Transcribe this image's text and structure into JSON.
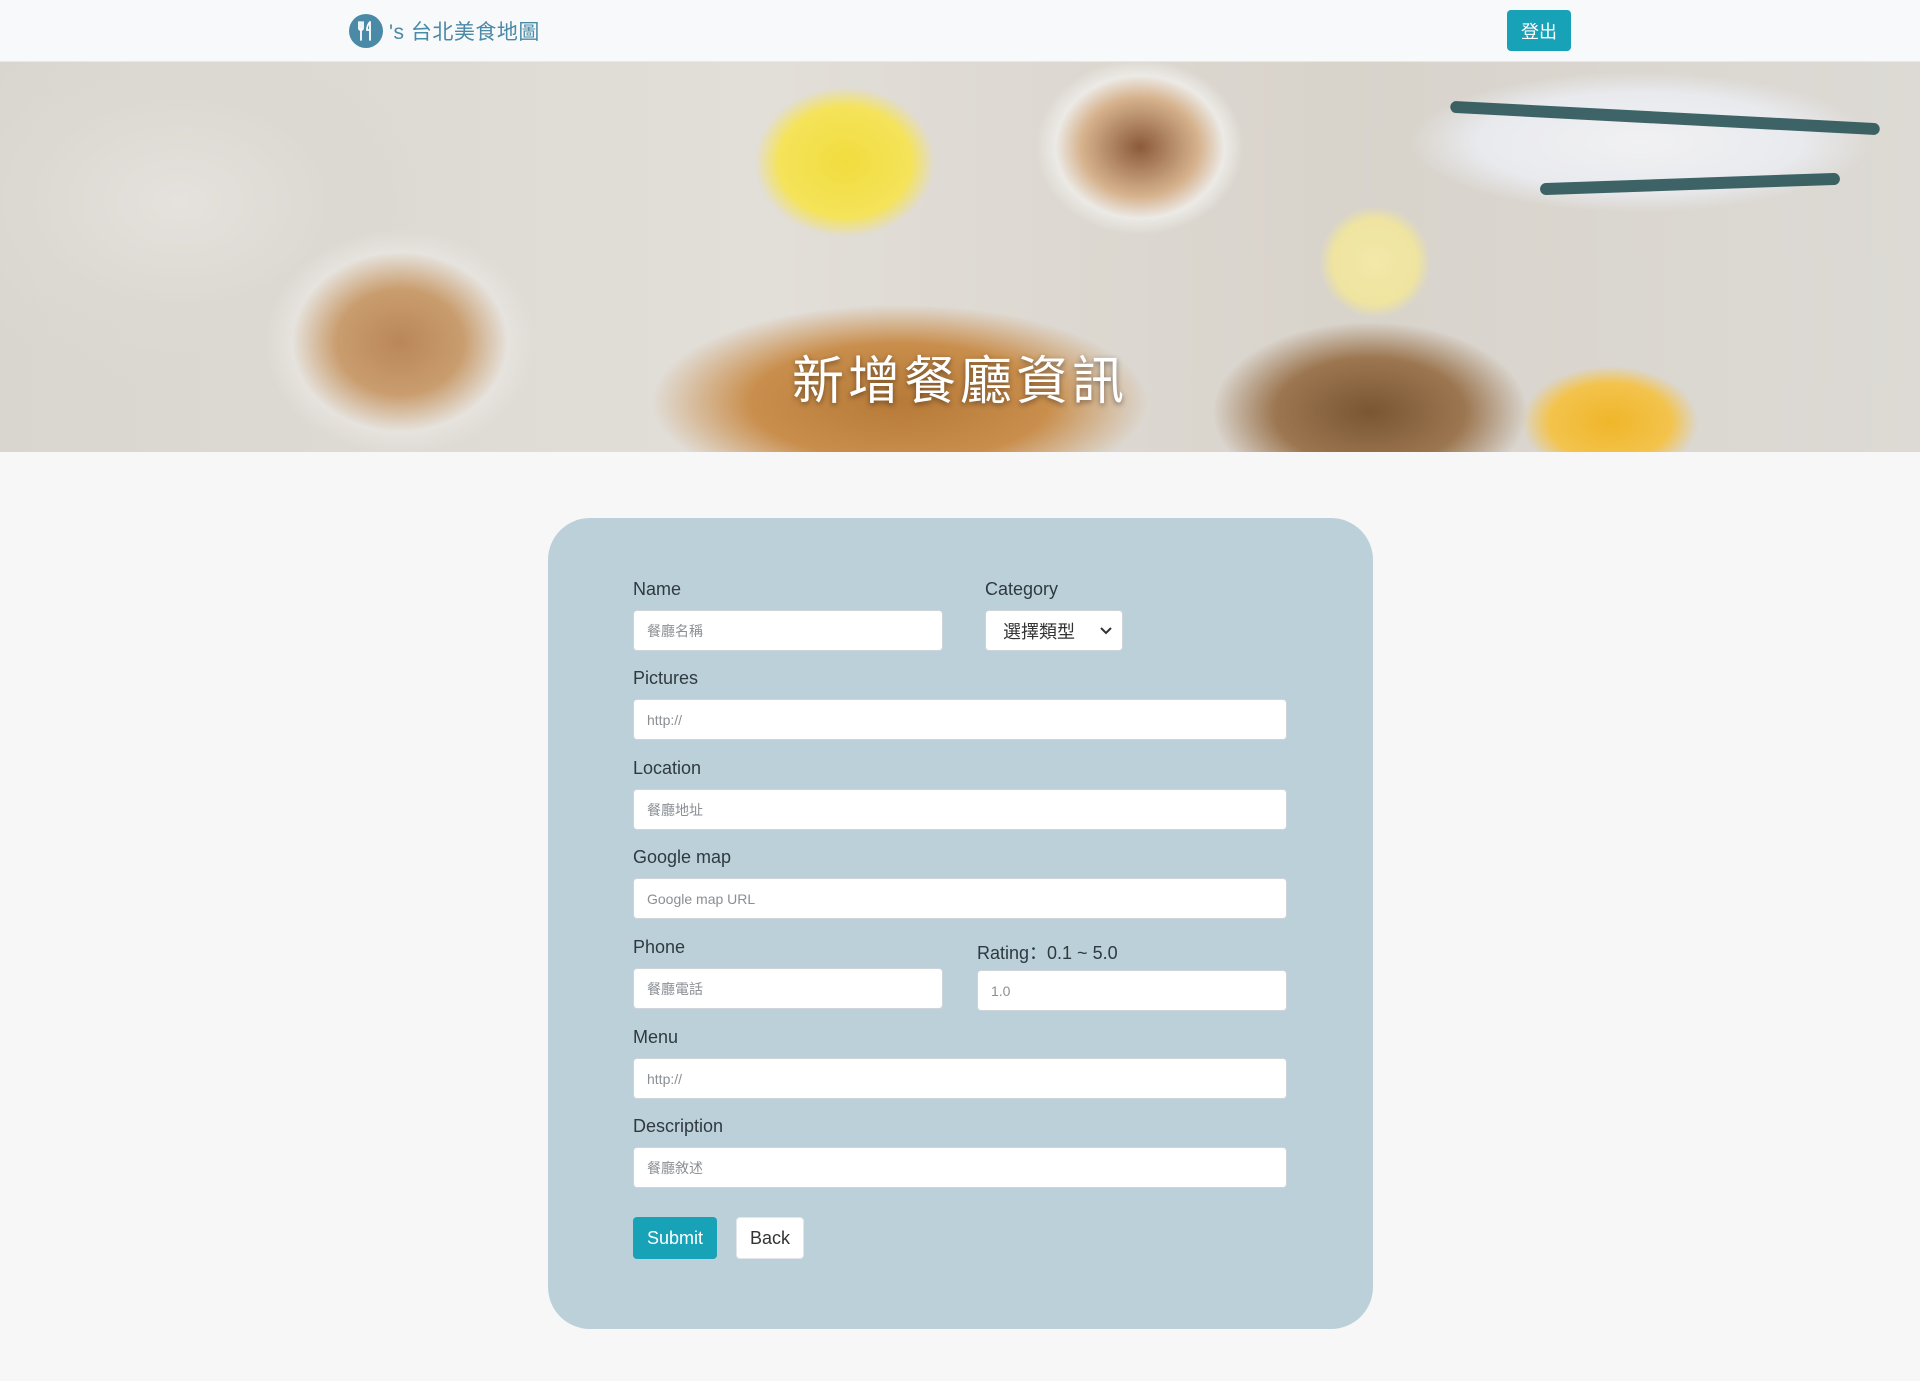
{
  "navbar": {
    "brand_text": "'s 台北美食地圖",
    "brand_icon": "utensils-icon",
    "logout_label": "登出",
    "accent_color": "#17a2b8",
    "brand_color": "#4a8aa6"
  },
  "banner": {
    "title": "新增餐廳資訊"
  },
  "form": {
    "background_color": "#bcd0d9",
    "name": {
      "label": "Name",
      "placeholder": "餐廳名稱",
      "value": ""
    },
    "category": {
      "label": "Category",
      "selected": "選擇類型"
    },
    "pictures": {
      "label": "Pictures",
      "placeholder": "http://",
      "value": ""
    },
    "location": {
      "label": "Location",
      "placeholder": "餐廳地址",
      "value": ""
    },
    "google_map": {
      "label": "Google map",
      "placeholder": "Google map URL",
      "value": ""
    },
    "phone": {
      "label": "Phone",
      "placeholder": "餐廳電話",
      "value": ""
    },
    "rating": {
      "label": "Rating：0.1 ~ 5.0",
      "placeholder": "1.0",
      "value": ""
    },
    "menu": {
      "label": "Menu",
      "placeholder": "http://",
      "value": ""
    },
    "description": {
      "label": "Description",
      "placeholder": "餐廳敘述",
      "value": ""
    },
    "submit_label": "Submit",
    "back_label": "Back"
  }
}
